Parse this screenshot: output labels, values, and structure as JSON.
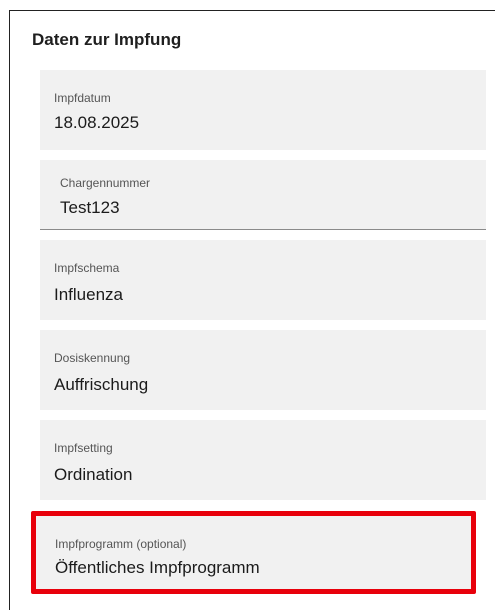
{
  "section": {
    "title": "Daten zur Impfung"
  },
  "fields": {
    "impfdatum": {
      "label": "Impfdatum",
      "value": "18.08.2025"
    },
    "chargennummer": {
      "label": "Chargennummer",
      "value": "Test123"
    },
    "impfschema": {
      "label": "Impfschema",
      "value": "Influenza"
    },
    "dosiskennung": {
      "label": "Dosiskennung",
      "value": "Auffrischung"
    },
    "impfsetting": {
      "label": "Impfsetting",
      "value": "Ordination"
    },
    "impfprogramm": {
      "label": "Impfprogramm (optional)",
      "value": "Öffentliches Impfprogramm"
    }
  },
  "colors": {
    "highlight": "#e8000b",
    "field_background": "#f1f1f1"
  }
}
